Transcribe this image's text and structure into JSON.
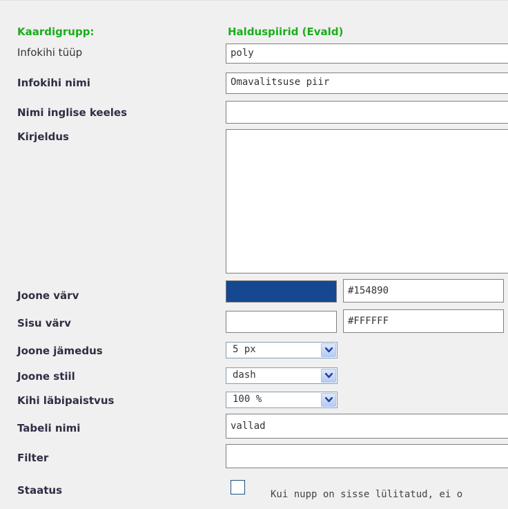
{
  "form": {
    "kaardigrupp": {
      "label": "Kaardigrupp:",
      "value": "Halduspiirid (Evald)"
    },
    "infokihi_tyyp": {
      "label": "Infokihi tüüp",
      "value": "poly"
    },
    "infokihi_nimi": {
      "label": "Infokihi nimi",
      "value": "Omavalitsuse piir"
    },
    "nimi_inglise": {
      "label": "Nimi inglise keeles",
      "value": ""
    },
    "kirjeldus": {
      "label": "Kirjeldus",
      "value": ""
    },
    "joone_varv": {
      "label": "Joone värv",
      "color": "#154890",
      "hex": "#154890"
    },
    "sisu_varv": {
      "label": "Sisu värv",
      "color": "#FFFFFF",
      "hex": "#FFFFFF"
    },
    "joone_jamedus": {
      "label": "Joone jämedus",
      "selected": "5 px"
    },
    "joone_stiil": {
      "label": "Joone stiil",
      "selected": "dash"
    },
    "labipaistvus": {
      "label": "Kihi läbipaistvus",
      "selected": "100 %"
    },
    "tabeli_nimi": {
      "label": "Tabeli nimi",
      "value": "vallad"
    },
    "filter": {
      "label": "Filter",
      "value": ""
    },
    "staatus": {
      "label": "Staatus",
      "checked": false,
      "hint": "Kui nupp on sisse lülitatud, ei o"
    }
  },
  "icons": {
    "dropdown": "chevron-down-icon"
  },
  "colors": {
    "label_green": "#1aad1a",
    "label_dark": "#2e2e44",
    "panel_bg": "#f0f0f0",
    "dropdown_arrow": "#2a3f9a"
  }
}
